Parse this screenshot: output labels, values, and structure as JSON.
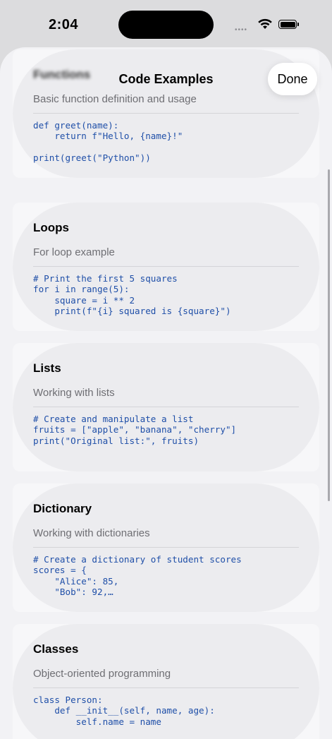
{
  "status": {
    "time": "2:04"
  },
  "nav": {
    "title": "Code Examples",
    "done_label": "Done"
  },
  "cards": [
    {
      "title": "Functions",
      "description": "Basic function definition and usage",
      "code": "def greet(name):\n    return f\"Hello, {name}!\"\n\nprint(greet(\"Python\"))"
    },
    {
      "title": "Loops",
      "description": "For loop example",
      "code": "# Print the first 5 squares\nfor i in range(5):\n    square = i ** 2\n    print(f\"{i} squared is {square}\")"
    },
    {
      "title": "Lists",
      "description": "Working with lists",
      "code": "# Create and manipulate a list\nfruits = [\"apple\", \"banana\", \"cherry\"]\nprint(\"Original list:\", fruits)"
    },
    {
      "title": "Dictionary",
      "description": "Working with dictionaries",
      "code": "# Create a dictionary of student scores\nscores = {\n    \"Alice\": 85,\n    \"Bob\": 92,…"
    },
    {
      "title": "Classes",
      "description": "Object-oriented programming",
      "code": "class Person:\n    def __init__(self, name, age):\n        self.name = name"
    }
  ]
}
